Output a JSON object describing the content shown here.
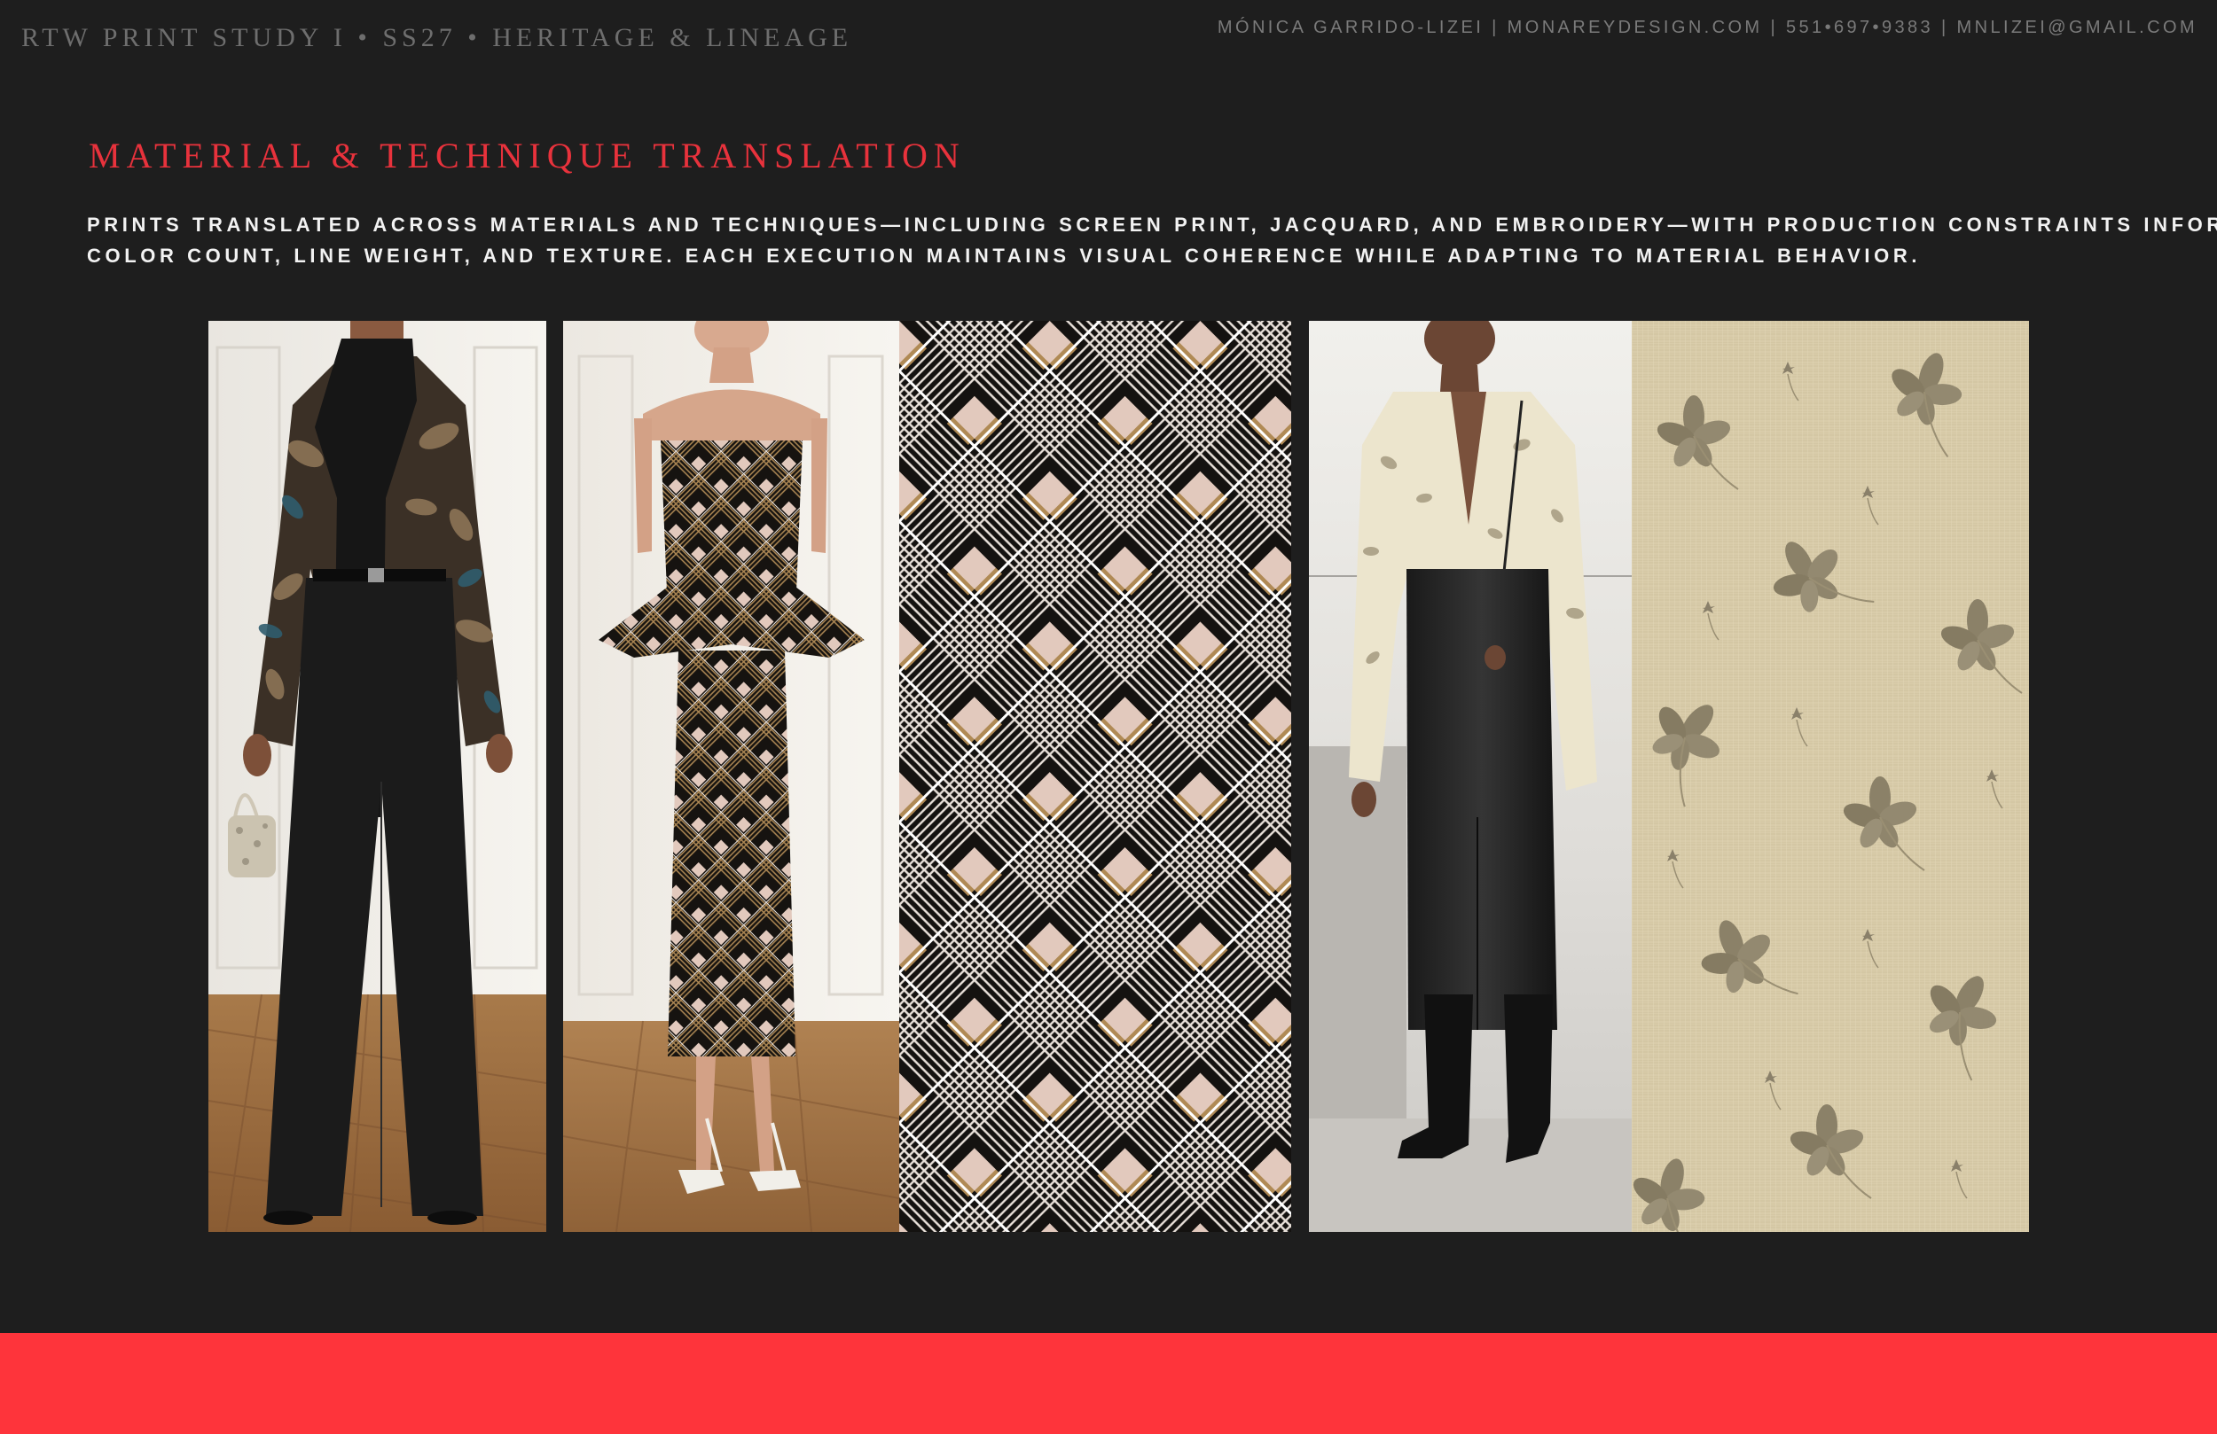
{
  "header": {
    "left_text": "RTW PRINT STUDY I • SS27 • HERITAGE & LINEAGE",
    "right_text": "MÓNICA GARRIDO-LIZEI | MONAREYDESIGN.COM | 551•697•9383 | MNLIZEI@GMAIL.COM"
  },
  "section": {
    "title": "MATERIAL & TECHNIQUE TRANSLATION",
    "description_lines": [
      "PRINTS TRANSLATED ACROSS MATERIALS AND TECHNIQUES—INCLUDING SCREEN PRINT, JACQUARD, AND EMBROIDERY—WITH PRODUCTION CONSTRAINTS INFORMING",
      "COLOR COUNT, LINE WEIGHT, AND TEXTURE. EACH EXECUTION MAINTAINS VISUAL COHERENCE WHILE ADAPTING TO MATERIAL BEHAVIOR."
    ]
  },
  "colors": {
    "background": "#1e1e1e",
    "accent": "#e8323c",
    "footer_bar": "#fe343b",
    "plaid_black": "#141210",
    "plaid_blush": "#e2c9bd",
    "plaid_tan": "#b08a55",
    "floral_cream": "#d9ccaa",
    "floral_motif": "#8b8168"
  }
}
